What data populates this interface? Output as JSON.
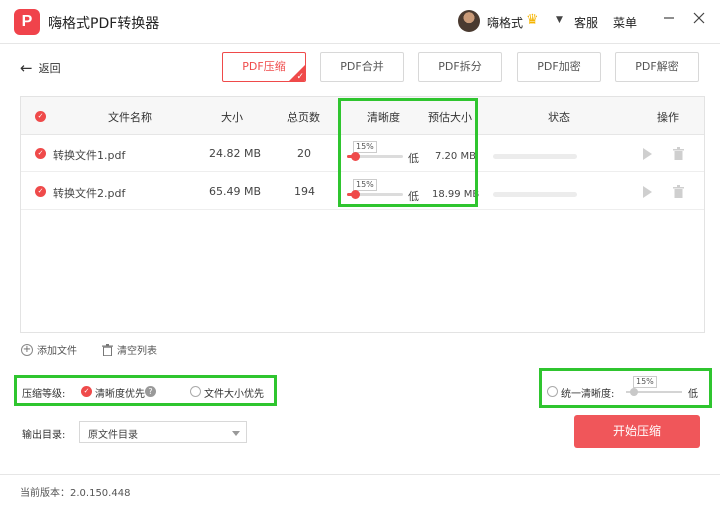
{
  "app": {
    "logo": "P",
    "title": "嗨格式PDF转换器",
    "user": "嗨格式",
    "service": "客服",
    "menu": "菜单"
  },
  "nav": {
    "back": "返回"
  },
  "tabs": [
    {
      "label": "PDF压缩",
      "active": true
    },
    {
      "label": "PDF合并",
      "active": false
    },
    {
      "label": "PDF拆分",
      "active": false
    },
    {
      "label": "PDF加密",
      "active": false
    },
    {
      "label": "PDF解密",
      "active": false
    }
  ],
  "table": {
    "headers": {
      "name": "文件名称",
      "size": "大小",
      "pages": "总页数",
      "clarity": "清晰度",
      "estimate": "预估大小",
      "status": "状态",
      "action": "操作"
    },
    "rows": [
      {
        "name": "转换文件1.pdf",
        "size": "24.82 MB",
        "pages": "20",
        "percent": "15%",
        "level": "低",
        "estimate": "7.20 MB",
        "clarity_value": 0.15,
        "progress": 0
      },
      {
        "name": "转换文件2.pdf",
        "size": "65.49 MB",
        "pages": "194",
        "percent": "15%",
        "level": "低",
        "estimate": "18.99 MB",
        "clarity_value": 0.15,
        "progress": 0
      }
    ]
  },
  "tools": {
    "add": "添加文件",
    "clear": "清空列表"
  },
  "compress": {
    "label": "压缩等级:",
    "option1": "清晰度优先",
    "help": "?",
    "option2": "文件大小优先",
    "selected": "清晰度优先"
  },
  "unified": {
    "label": "统一清晰度:",
    "percent": "15%",
    "level": "低",
    "value": 0.15
  },
  "output": {
    "label": "输出目录:",
    "value": "原文件目录"
  },
  "start_button": "开始压缩",
  "footer": {
    "version": "当前版本：2.0.150.448"
  },
  "colors": {
    "accent": "#ef4a4a",
    "highlight": "#2fc52f",
    "button": "#f0565a"
  }
}
